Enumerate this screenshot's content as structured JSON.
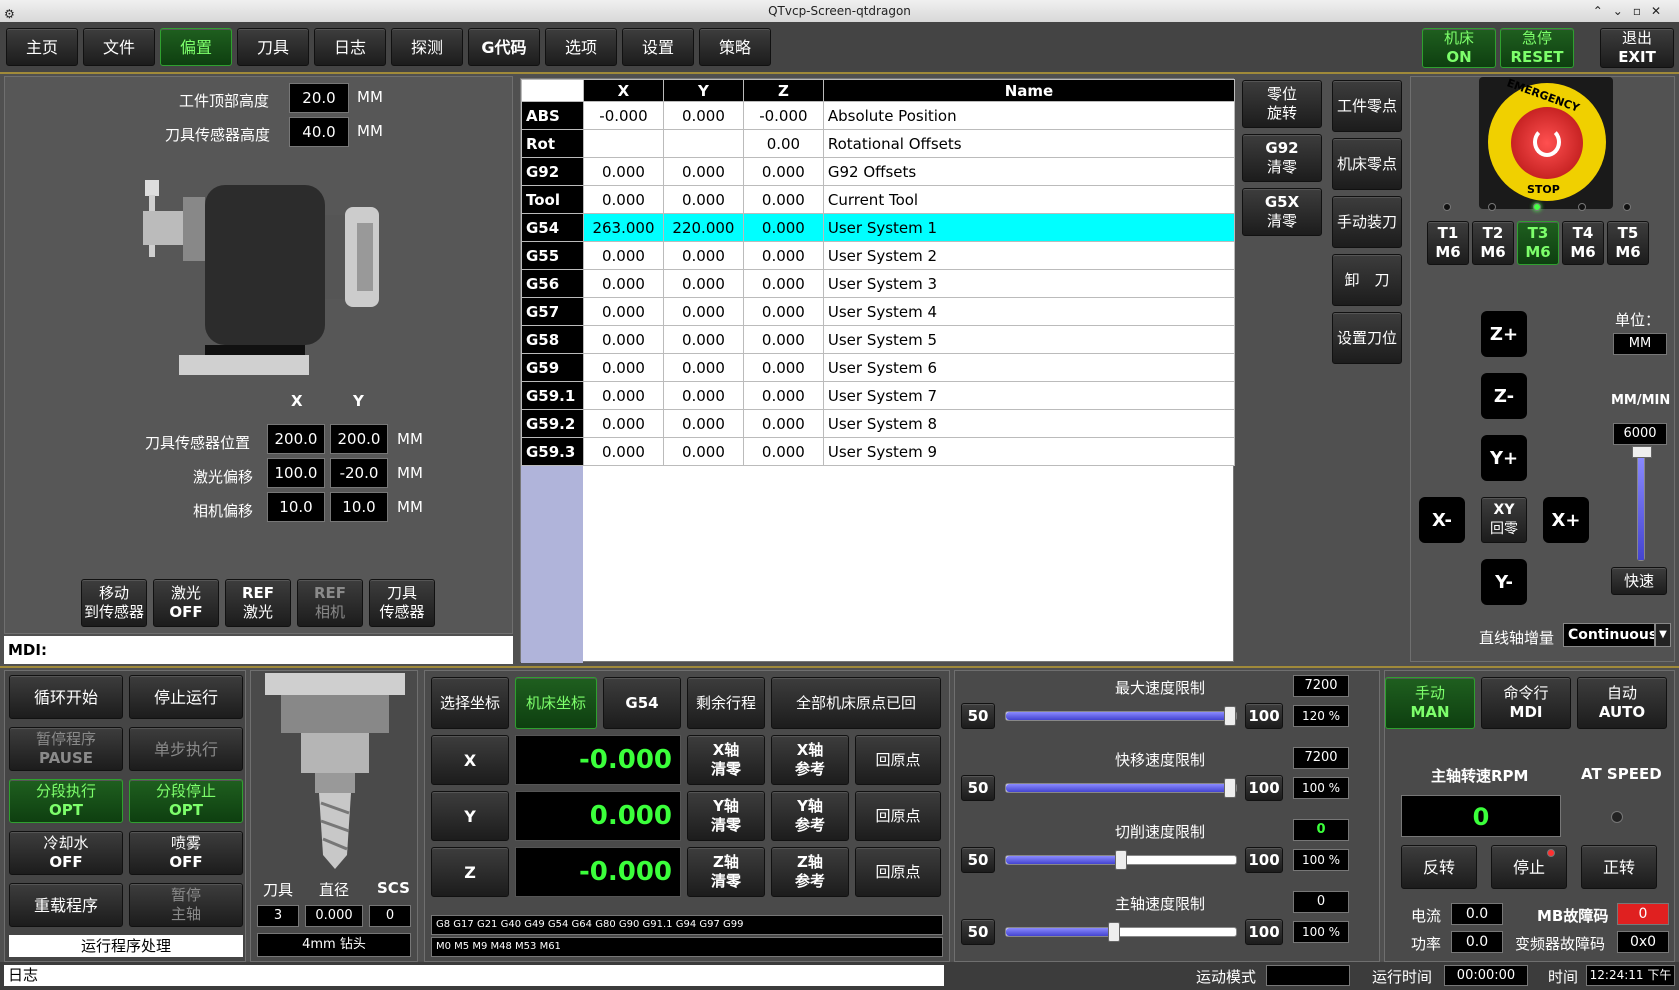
{
  "window": {
    "title": "QTvcp-Screen-qtdragon"
  },
  "tabs": [
    "主页",
    "文件",
    "偏置",
    "刀具",
    "日志",
    "探测",
    "G代码",
    "选项",
    "设置",
    "策略"
  ],
  "active_tab_index": 2,
  "top_right": {
    "machine_l1": "机床",
    "machine_l2": "ON",
    "estop_l1": "急停",
    "estop_l2": "RESET",
    "exit_l1": "退出",
    "exit_l2": "EXIT"
  },
  "left_panel": {
    "workpiece_top_label": "工件顶部高度",
    "workpiece_top_value": "20.0",
    "workpiece_top_unit": "MM",
    "sensor_height_label": "刀具传感器高度",
    "sensor_height_value": "40.0",
    "sensor_height_unit": "MM",
    "col_x": "X",
    "col_y": "Y",
    "sensor_pos_label": "刀具传感器位置",
    "sensor_pos_x": "200.0",
    "sensor_pos_y": "200.0",
    "laser_offset_label": "激光偏移",
    "laser_offset_x": "100.0",
    "laser_offset_y": "-20.0",
    "camera_offset_label": "相机偏移",
    "camera_offset_x": "10.0",
    "camera_offset_y": "10.0",
    "unit": "MM",
    "buttons": [
      {
        "l1": "移动",
        "l2": "到传感器"
      },
      {
        "l1": "激光",
        "l2": "OFF"
      },
      {
        "l1": "REF",
        "l2": "激光"
      },
      {
        "l1": "REF",
        "l2": "相机"
      },
      {
        "l1": "刀具",
        "l2": "传感器"
      }
    ],
    "mdi_label": "MDI:"
  },
  "offsets_table": {
    "headers": [
      "",
      "X",
      "Y",
      "Z",
      "Name"
    ],
    "rows": [
      [
        "ABS",
        "-0.000",
        "0.000",
        "-0.000",
        "Absolute Position"
      ],
      [
        "Rot",
        "",
        "",
        "0.00",
        "Rotational Offsets"
      ],
      [
        "G92",
        "0.000",
        "0.000",
        "0.000",
        "G92 Offsets"
      ],
      [
        "Tool",
        "0.000",
        "0.000",
        "0.000",
        "Current Tool"
      ],
      [
        "G54",
        "263.000",
        "220.000",
        "0.000",
        "User System 1"
      ],
      [
        "G55",
        "0.000",
        "0.000",
        "0.000",
        "User System 2"
      ],
      [
        "G56",
        "0.000",
        "0.000",
        "0.000",
        "User System 3"
      ],
      [
        "G57",
        "0.000",
        "0.000",
        "0.000",
        "User System 4"
      ],
      [
        "G58",
        "0.000",
        "0.000",
        "0.000",
        "User System 5"
      ],
      [
        "G59",
        "0.000",
        "0.000",
        "0.000",
        "User System 6"
      ],
      [
        "G59.1",
        "0.000",
        "0.000",
        "0.000",
        "User System 7"
      ],
      [
        "G59.2",
        "0.000",
        "0.000",
        "0.000",
        "User System 8"
      ],
      [
        "G59.3",
        "0.000",
        "0.000",
        "0.000",
        "User System 9"
      ]
    ],
    "selected_row": 4
  },
  "offset_buttons": {
    "zero_rot_l1": "零位",
    "zero_rot_l2": "旋转",
    "g92_l1": "G92",
    "g92_l2": "清零",
    "g5x_l1": "G5X",
    "g5x_l2": "清零",
    "work_zero": "工件零点",
    "machine_zero": "机床零点",
    "manual_tool": "手动装刀",
    "unload_tool": "卸　刀",
    "set_tool": "设置刀位"
  },
  "tools": [
    {
      "t": "T1",
      "m": "M6"
    },
    {
      "t": "T2",
      "m": "M6"
    },
    {
      "t": "T3",
      "m": "M6"
    },
    {
      "t": "T4",
      "m": "M6"
    },
    {
      "t": "T5",
      "m": "M6"
    }
  ],
  "jog": {
    "z_plus": "Z+",
    "z_minus": "Z-",
    "y_plus": "Y+",
    "y_minus": "Y-",
    "x_minus": "X-",
    "x_plus": "X+",
    "xy_home_l1": "XY",
    "xy_home_l2": "回零",
    "unit_label": "单位：",
    "unit_value": "MM",
    "rate_label": "MM/MIN",
    "rate_value": "6000",
    "rapid": "快速",
    "increment_label": "直线轴增量",
    "increment_value": "Continuous"
  },
  "program_ctrl": {
    "cycle_start": "循环开始",
    "stop": "停止运行",
    "pause_l1": "暂停程序",
    "pause_l2": "PAUSE",
    "step": "单步执行",
    "opt_run_l1": "分段执行",
    "opt_run_l2": "OPT",
    "opt_stop_l1": "分段停止",
    "opt_stop_l2": "OPT",
    "coolant_l1": "冷却水",
    "coolant_l2": "OFF",
    "mist_l1": "喷雾",
    "mist_l2": "OFF",
    "reload": "重载程序",
    "pause_spindle_l1": "暂停",
    "pause_spindle_l2": "主轴",
    "run_handler": "运行程序处理"
  },
  "tool_info": {
    "tool_label": "刀具",
    "diam_label": "直径",
    "scs_label": "SCS",
    "tool": "3",
    "diam": "0.000",
    "scs": "0",
    "desc": "4mm 钻头"
  },
  "dro": {
    "select_coord": "选择坐标",
    "machine_coord": "机床坐标",
    "g54": "G54",
    "dtg": "剩余行程",
    "all_homed": "全部机床原点已回",
    "axes": [
      {
        "name": "X",
        "value": "-0.000",
        "zero_l1": "X轴",
        "zero_l2": "清零",
        "ref_l1": "X轴",
        "ref_l2": "参考",
        "home": "回原点"
      },
      {
        "name": "Y",
        "value": "0.000",
        "zero_l1": "Y轴",
        "zero_l2": "清零",
        "ref_l1": "Y轴",
        "ref_l2": "参考",
        "home": "回原点"
      },
      {
        "name": "Z",
        "value": "-0.000",
        "zero_l1": "Z轴",
        "zero_l2": "清零",
        "ref_l1": "Z轴",
        "ref_l2": "参考",
        "home": "回原点"
      }
    ],
    "gcodes": "G8 G17 G21 G40 G49 G54 G64 G80 G90 G91.1 G94 G97 G99",
    "mcodes": "M0 M5 M9 M48 M53 M61"
  },
  "overrides": [
    {
      "label": "最大速度限制",
      "value": "7200",
      "min": "50",
      "max": "100",
      "pct": "120 %",
      "fraction": 1.0
    },
    {
      "label": "快移速度限制",
      "value": "7200",
      "min": "50",
      "max": "100",
      "pct": "100 %",
      "fraction": 1.0
    },
    {
      "label": "切削速度限制",
      "value": "0",
      "min": "50",
      "max": "100",
      "pct": "100 %",
      "fraction": 0.5
    },
    {
      "label": "主轴速度限制",
      "value": "0",
      "min": "50",
      "max": "100",
      "pct": "100 %",
      "fraction": 0.47
    }
  ],
  "modes": {
    "man_l1": "手动",
    "man_l2": "MAN",
    "mdi_l1": "命令行",
    "mdi_l2": "MDI",
    "auto_l1": "自动",
    "auto_l2": "AUTO"
  },
  "spindle": {
    "rpm_label": "主轴转速RPM",
    "rpm": "0",
    "at_speed": "AT SPEED",
    "rev": "反转",
    "stop": "停止",
    "fwd": "正转",
    "current_label": "电流",
    "current": "0.0",
    "power_label": "功率",
    "power": "0.0",
    "mb_fault_label": "MB故障码",
    "mb_fault": "0",
    "vfd_fault_label": "变频器故障码",
    "vfd_fault": "0x0"
  },
  "status": {
    "log": "日志",
    "motion_label": "运动模式",
    "run_time_label": "运行时间",
    "run_time": "00:00:00",
    "time_label": "时间",
    "time": "12:24:11 下午"
  },
  "colors": {
    "accent_green": "#3bff3b",
    "selected_row": "#00ffff",
    "estop_red": "#e02020"
  }
}
